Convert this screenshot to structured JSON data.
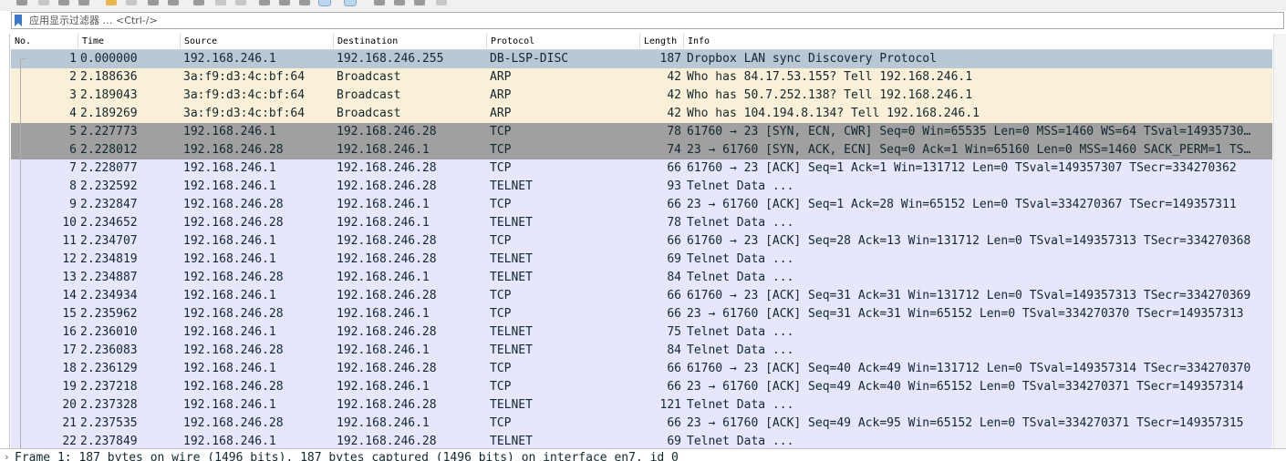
{
  "filter": {
    "placeholder": "应用显示过滤器 … <Ctrl-/>",
    "value": ""
  },
  "columns": [
    "No.",
    "Time",
    "Source",
    "Destination",
    "Protocol",
    "Length",
    "Info"
  ],
  "colors": {
    "dropbox_bg": "#b8c8d4",
    "arp_bg": "#faf0d7",
    "tcp_flag_bg": "#a0a0a0",
    "tcp_bg": "#e7e6ff"
  },
  "packets": [
    {
      "no": "1",
      "time": "0.000000",
      "src": "192.168.246.1",
      "dst": "192.168.246.255",
      "proto": "DB-LSP-DISC",
      "len": "187",
      "info": "Dropbox LAN sync Discovery Protocol",
      "style": "dropbox"
    },
    {
      "no": "2",
      "time": "2.188636",
      "src": "3a:f9:d3:4c:bf:64",
      "dst": "Broadcast",
      "proto": "ARP",
      "len": "42",
      "info": "Who has 84.17.53.155? Tell 192.168.246.1",
      "style": "arp"
    },
    {
      "no": "3",
      "time": "2.189043",
      "src": "3a:f9:d3:4c:bf:64",
      "dst": "Broadcast",
      "proto": "ARP",
      "len": "42",
      "info": "Who has 50.7.252.138? Tell 192.168.246.1",
      "style": "arp"
    },
    {
      "no": "4",
      "time": "2.189269",
      "src": "3a:f9:d3:4c:bf:64",
      "dst": "Broadcast",
      "proto": "ARP",
      "len": "42",
      "info": "Who has 104.194.8.134? Tell 192.168.246.1",
      "style": "arp"
    },
    {
      "no": "5",
      "time": "2.227773",
      "src": "192.168.246.1",
      "dst": "192.168.246.28",
      "proto": "TCP",
      "len": "78",
      "info": "61760 → 23 [SYN, ECN, CWR] Seq=0 Win=65535 Len=0 MSS=1460 WS=64 TSval=14935730…",
      "style": "flag"
    },
    {
      "no": "6",
      "time": "2.228012",
      "src": "192.168.246.28",
      "dst": "192.168.246.1",
      "proto": "TCP",
      "len": "74",
      "info": "23 → 61760 [SYN, ACK, ECN] Seq=0 Ack=1 Win=65160 Len=0 MSS=1460 SACK_PERM=1 TS…",
      "style": "flag"
    },
    {
      "no": "7",
      "time": "2.228077",
      "src": "192.168.246.1",
      "dst": "192.168.246.28",
      "proto": "TCP",
      "len": "66",
      "info": "61760 → 23 [ACK] Seq=1 Ack=1 Win=131712 Len=0 TSval=149357307 TSecr=334270362",
      "style": "tcp"
    },
    {
      "no": "8",
      "time": "2.232592",
      "src": "192.168.246.1",
      "dst": "192.168.246.28",
      "proto": "TELNET",
      "len": "93",
      "info": "Telnet Data ...",
      "style": "tcp"
    },
    {
      "no": "9",
      "time": "2.232847",
      "src": "192.168.246.28",
      "dst": "192.168.246.1",
      "proto": "TCP",
      "len": "66",
      "info": "23 → 61760 [ACK] Seq=1 Ack=28 Win=65152 Len=0 TSval=334270367 TSecr=149357311",
      "style": "tcp"
    },
    {
      "no": "10",
      "time": "2.234652",
      "src": "192.168.246.28",
      "dst": "192.168.246.1",
      "proto": "TELNET",
      "len": "78",
      "info": "Telnet Data ...",
      "style": "tcp"
    },
    {
      "no": "11",
      "time": "2.234707",
      "src": "192.168.246.1",
      "dst": "192.168.246.28",
      "proto": "TCP",
      "len": "66",
      "info": "61760 → 23 [ACK] Seq=28 Ack=13 Win=131712 Len=0 TSval=149357313 TSecr=334270368",
      "style": "tcp"
    },
    {
      "no": "12",
      "time": "2.234819",
      "src": "192.168.246.1",
      "dst": "192.168.246.28",
      "proto": "TELNET",
      "len": "69",
      "info": "Telnet Data ...",
      "style": "tcp"
    },
    {
      "no": "13",
      "time": "2.234887",
      "src": "192.168.246.28",
      "dst": "192.168.246.1",
      "proto": "TELNET",
      "len": "84",
      "info": "Telnet Data ...",
      "style": "tcp"
    },
    {
      "no": "14",
      "time": "2.234934",
      "src": "192.168.246.1",
      "dst": "192.168.246.28",
      "proto": "TCP",
      "len": "66",
      "info": "61760 → 23 [ACK] Seq=31 Ack=31 Win=131712 Len=0 TSval=149357313 TSecr=334270369",
      "style": "tcp"
    },
    {
      "no": "15",
      "time": "2.235962",
      "src": "192.168.246.28",
      "dst": "192.168.246.1",
      "proto": "TCP",
      "len": "66",
      "info": "23 → 61760 [ACK] Seq=31 Ack=31 Win=65152 Len=0 TSval=334270370 TSecr=149357313",
      "style": "tcp"
    },
    {
      "no": "16",
      "time": "2.236010",
      "src": "192.168.246.1",
      "dst": "192.168.246.28",
      "proto": "TELNET",
      "len": "75",
      "info": "Telnet Data ...",
      "style": "tcp"
    },
    {
      "no": "17",
      "time": "2.236083",
      "src": "192.168.246.28",
      "dst": "192.168.246.1",
      "proto": "TELNET",
      "len": "84",
      "info": "Telnet Data ...",
      "style": "tcp"
    },
    {
      "no": "18",
      "time": "2.236129",
      "src": "192.168.246.1",
      "dst": "192.168.246.28",
      "proto": "TCP",
      "len": "66",
      "info": "61760 → 23 [ACK] Seq=40 Ack=49 Win=131712 Len=0 TSval=149357314 TSecr=334270370",
      "style": "tcp"
    },
    {
      "no": "19",
      "time": "2.237218",
      "src": "192.168.246.28",
      "dst": "192.168.246.1",
      "proto": "TCP",
      "len": "66",
      "info": "23 → 61760 [ACK] Seq=49 Ack=40 Win=65152 Len=0 TSval=334270371 TSecr=149357314",
      "style": "tcp"
    },
    {
      "no": "20",
      "time": "2.237328",
      "src": "192.168.246.1",
      "dst": "192.168.246.28",
      "proto": "TELNET",
      "len": "121",
      "info": "Telnet Data ...",
      "style": "tcp"
    },
    {
      "no": "21",
      "time": "2.237535",
      "src": "192.168.246.28",
      "dst": "192.168.246.1",
      "proto": "TCP",
      "len": "66",
      "info": "23 → 61760 [ACK] Seq=49 Ack=95 Win=65152 Len=0 TSval=334270371 TSecr=149357315",
      "style": "tcp"
    },
    {
      "no": "22",
      "time": "2.237849",
      "src": "192.168.246.1",
      "dst": "192.168.246.28",
      "proto": "TELNET",
      "len": "69",
      "info": "Telnet Data ...",
      "style": "tcp"
    }
  ],
  "details": {
    "expander": "›",
    "frame_line": "Frame 1: 187 bytes on wire (1496 bits), 187 bytes captured (1496 bits) on interface en7, id 0"
  }
}
